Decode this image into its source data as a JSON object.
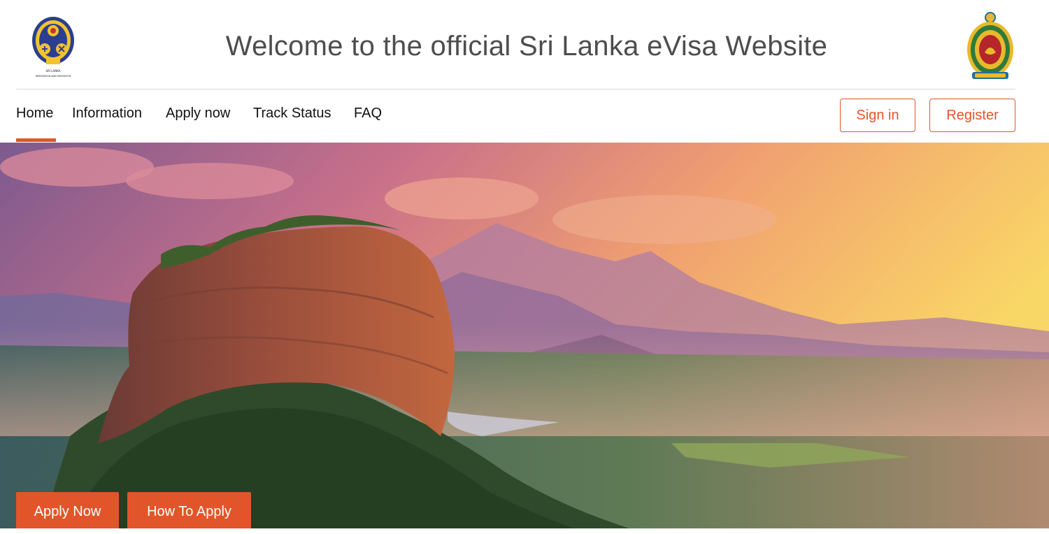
{
  "header": {
    "title": "Welcome to the official Sri Lanka eVisa Website",
    "left_logo": {
      "icon": "immigration-emblem-icon",
      "caption_line1": "SRI LANKA",
      "caption_line2": "IMMIGRATION AND EMIGRATION"
    },
    "right_logo": {
      "icon": "sri-lanka-state-emblem-icon"
    }
  },
  "nav": {
    "items": [
      {
        "label": "Home",
        "active": true
      },
      {
        "label": "Information",
        "active": false
      },
      {
        "label": "Apply now",
        "active": false
      },
      {
        "label": "Track Status",
        "active": false
      },
      {
        "label": "FAQ",
        "active": false
      }
    ],
    "sign_in_label": "Sign in",
    "register_label": "Register"
  },
  "hero": {
    "image": "sigiriya-rock-sunset-photo",
    "apply_now_label": "Apply Now",
    "how_to_apply_label": "How To Apply"
  },
  "colors": {
    "accent": "#e2552a",
    "title_text": "#4d4d4d",
    "nav_text": "#111111",
    "divider": "#d9d9d9"
  }
}
